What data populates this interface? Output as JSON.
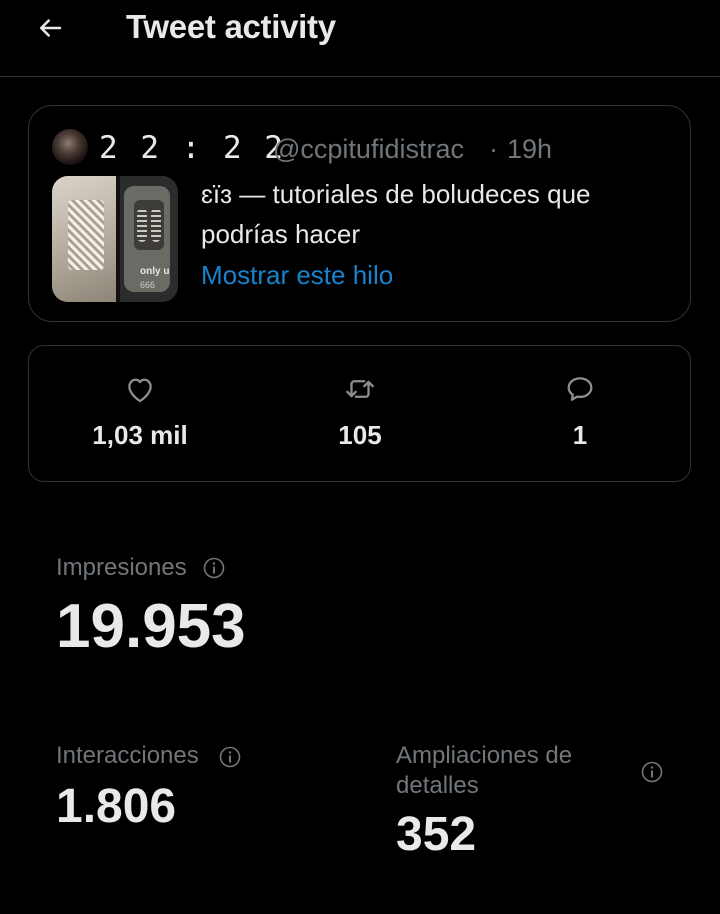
{
  "header": {
    "title": "Tweet activity"
  },
  "tweet": {
    "author_name": "2 2 :  2 2",
    "handle": "@ccpitufidistrac",
    "separator": "·",
    "time": "19h",
    "text": "ɛïɜ — tutoriales de boludeces que podrías hacer",
    "show_thread": "Mostrar este hilo",
    "thumbnail_caption": "only u",
    "thumbnail_subcaption": "666"
  },
  "engagement": {
    "likes": "1,03 mil",
    "retweets": "105",
    "replies": "1"
  },
  "metrics": {
    "impressions_label": "Impresiones",
    "impressions_value": "19.953",
    "interactions_label": "Interacciones",
    "interactions_value": "1.806",
    "detail_expands_label": "Ampliaciones de detalles",
    "detail_expands_value": "352"
  },
  "colors": {
    "background": "#000000",
    "text": "#e7e9ea",
    "muted": "#71767b",
    "accent": "#1d9bf0",
    "border": "#2f3336"
  }
}
